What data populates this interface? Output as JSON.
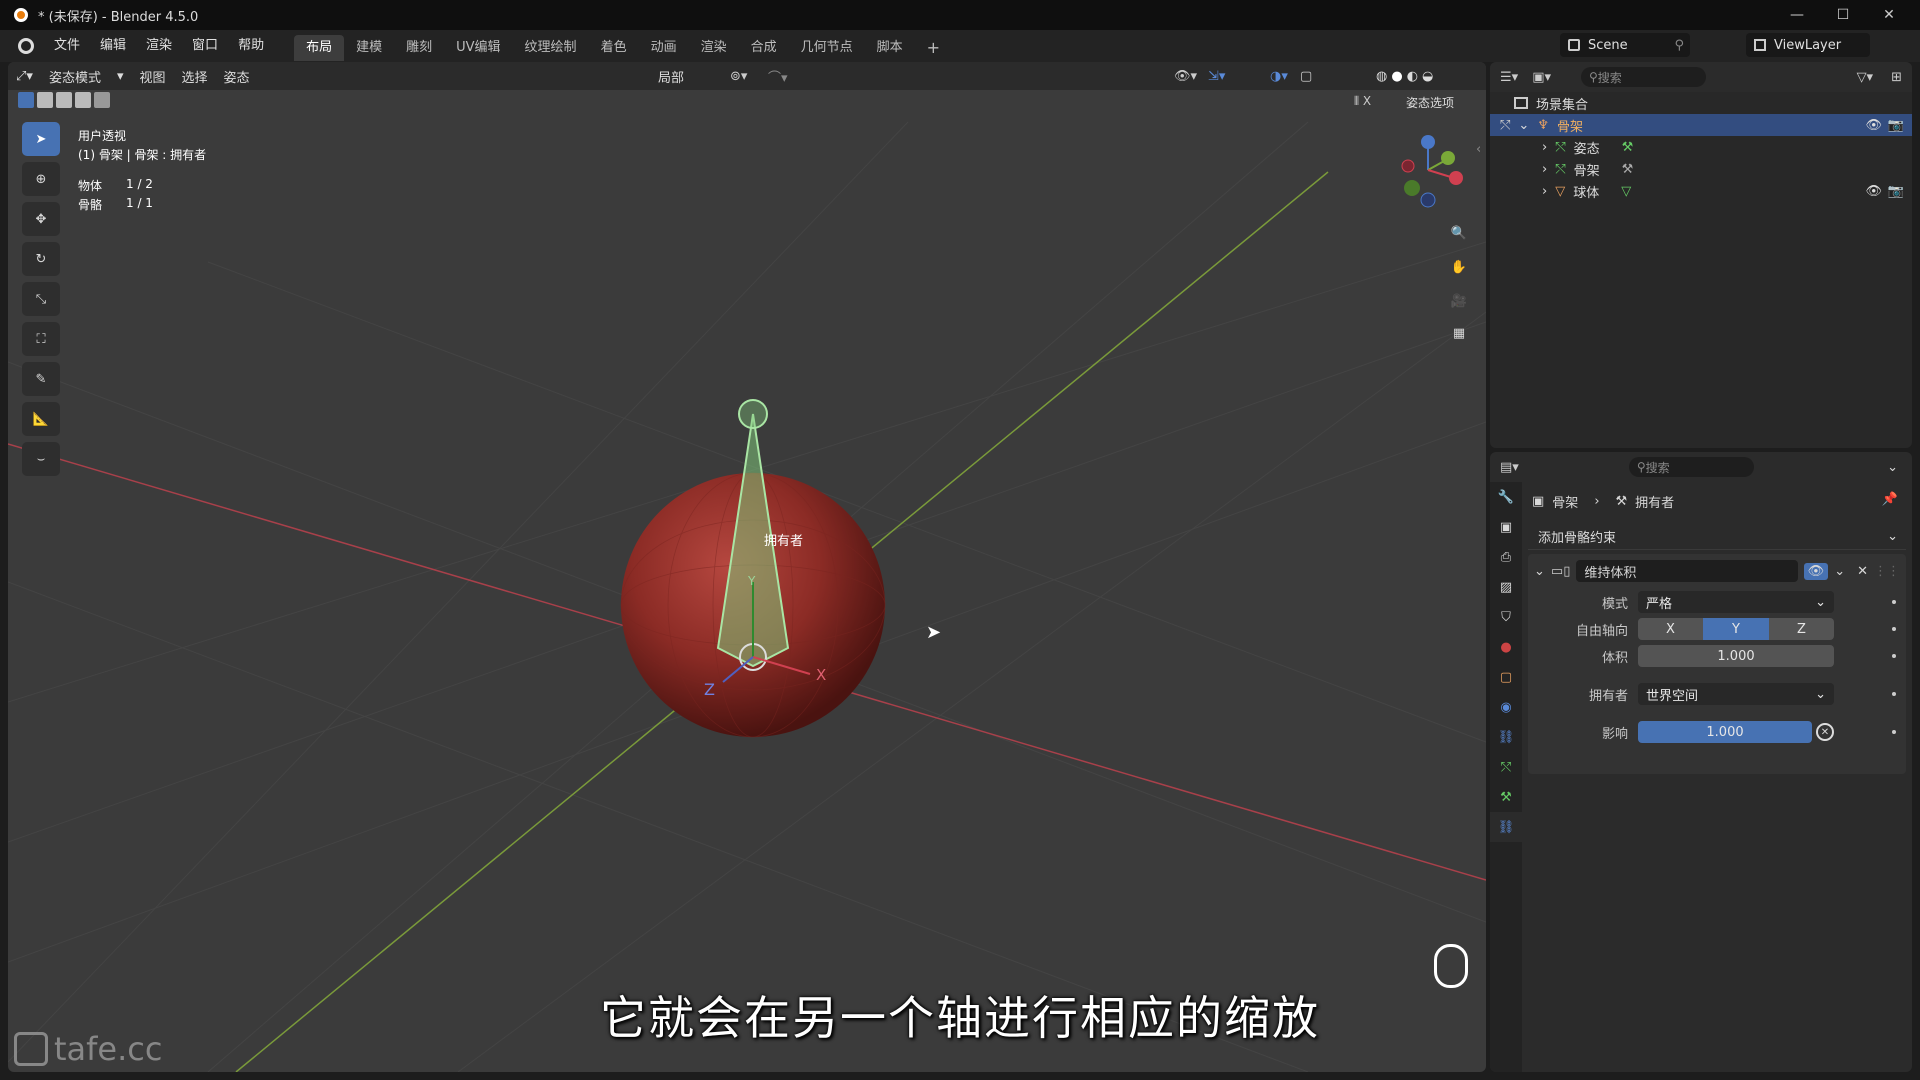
{
  "window": {
    "title": "* (未保存) - Blender 4.5.0",
    "minimize": "—",
    "maximize": "☐",
    "close": "✕"
  },
  "menu": {
    "items": [
      "文件",
      "编辑",
      "渲染",
      "窗口",
      "帮助"
    ]
  },
  "workspaces": {
    "tabs": [
      "布局",
      "建模",
      "雕刻",
      "UV编辑",
      "纹理绘制",
      "着色",
      "动画",
      "渲染",
      "合成",
      "几何节点",
      "脚本"
    ],
    "add": "+"
  },
  "topright": {
    "scene": "Scene",
    "view_layer": "ViewLayer"
  },
  "viewport": {
    "header": {
      "mode": "姿态模式",
      "view": "视图",
      "select": "选择",
      "pose": "姿态",
      "transform": "局部",
      "pose_options": "姿态选项",
      "x_label": "X"
    },
    "info": {
      "view_name": "用户透视",
      "context": "(1) 骨架 | 骨架 : 拥有者",
      "objects_label": "物体",
      "objects_value": "1 / 2",
      "bones_label": "骨骼",
      "bones_value": "1 / 1"
    },
    "bone_label": "拥有者",
    "axis_labels": {
      "x": "X",
      "y": "Y",
      "z": "Z"
    }
  },
  "subtitle": "它就会在另一个轴进行相应的缩放",
  "watermark": "tafe.cc",
  "outliner": {
    "search_placeholder": "搜索",
    "collection": "场景集合",
    "rows": [
      {
        "name": "骨架",
        "selected": true
      },
      {
        "name": "姿态"
      },
      {
        "name": "骨架"
      },
      {
        "name": "球体"
      }
    ]
  },
  "properties": {
    "search_placeholder": "搜索",
    "breadcrumb": {
      "object": "骨架",
      "bone": "拥有者"
    },
    "add_constraint": "添加骨骼约束",
    "constraint_name": "维持体积",
    "fields": {
      "mode_label": "模式",
      "mode_value": "严格",
      "free_axis_label": "自由轴向",
      "axes": [
        "X",
        "Y",
        "Z"
      ],
      "axis_selected": "Y",
      "volume_label": "体积",
      "volume_value": "1.000",
      "owner_label": "拥有者",
      "owner_value": "世界空间",
      "influence_label": "影响",
      "influence_value": "1.000"
    }
  },
  "colors": {
    "accent": "#4772b3",
    "selected_row": "#334d80",
    "sphere": "#8b2b25",
    "bone": "#7fc47a"
  }
}
